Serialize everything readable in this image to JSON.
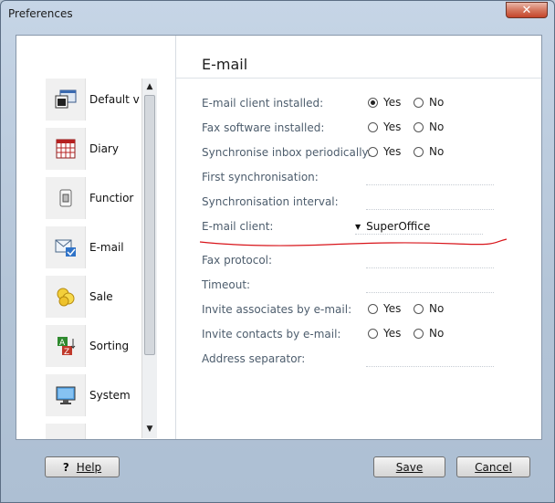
{
  "window": {
    "title": "Preferences",
    "close_label": "✕"
  },
  "nav": {
    "items": [
      {
        "label": "Default v",
        "icon": "default-values-icon"
      },
      {
        "label": "Diary",
        "icon": "diary-icon"
      },
      {
        "label": "Functior",
        "icon": "functions-icon"
      },
      {
        "label": "E-mail",
        "icon": "email-icon"
      },
      {
        "label": "Sale",
        "icon": "sale-coins-icon"
      },
      {
        "label": "Sorting",
        "icon": "sorting-az-icon"
      },
      {
        "label": "System",
        "icon": "system-monitor-icon"
      }
    ]
  },
  "page": {
    "title": "E-mail"
  },
  "settings": {
    "email_client_installed": {
      "label": "E-mail client installed:",
      "yes": "Yes",
      "no": "No",
      "value": "Yes"
    },
    "fax_software_installed": {
      "label": "Fax software installed:",
      "yes": "Yes",
      "no": "No",
      "value": ""
    },
    "sync_inbox": {
      "label": "Synchronise inbox periodically:",
      "yes": "Yes",
      "no": "No",
      "value": ""
    },
    "first_sync": {
      "label": "First synchronisation:",
      "value": ""
    },
    "sync_interval": {
      "label": "Synchronisation interval:",
      "value": ""
    },
    "email_client": {
      "label": "E-mail client:",
      "value": "SuperOffice"
    },
    "fax_protocol": {
      "label": "Fax protocol:",
      "value": ""
    },
    "timeout": {
      "label": "Timeout:",
      "value": ""
    },
    "invite_associates": {
      "label": "Invite associates by e-mail:",
      "yes": "Yes",
      "no": "No",
      "value": ""
    },
    "invite_contacts": {
      "label": "Invite contacts by e-mail:",
      "yes": "Yes",
      "no": "No",
      "value": ""
    },
    "address_separator": {
      "label": "Address separator:",
      "value": ""
    }
  },
  "buttons": {
    "help": "Help",
    "save": "Save",
    "cancel": "Cancel"
  },
  "colors": {
    "annotation_red": "#d8141a",
    "label_gray": "#4d5d6d"
  }
}
